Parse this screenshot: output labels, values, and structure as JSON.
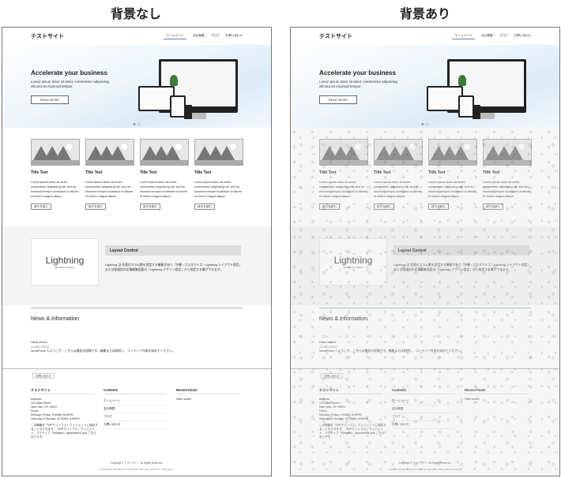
{
  "labels": {
    "left": "背景なし",
    "right": "背景あり"
  },
  "site": {
    "title": "テストサイト",
    "nav": [
      "ホームページ",
      "会社概要",
      "ブログ",
      "お問い合わせ"
    ],
    "hero": {
      "heading": "Accelerate your business",
      "text": "Lorem ipsum dolor sit amet, consectetur adipiscing elit,sed do eiusmod tempor.",
      "button": "READ MORE"
    },
    "cards": [
      {
        "title": "Title Text",
        "text": "Lorem ipsum dolor sit amet, consectetur adipiscing elit, sed do eiusmod tempor incididunt ut labore et dolore magna aliqua.",
        "button": "続きを読む"
      },
      {
        "title": "Title Text",
        "text": "Lorem ipsum dolor sit amet, consectetur adipiscing elit, sed do eiusmod tempor incididunt ut labore et dolore magna aliqua.",
        "button": "続きを読む"
      },
      {
        "title": "Title Text",
        "text": "Lorem ipsum dolor sit amet, consectetur adipiscing elit, sed do eiusmod tempor incididunt ut labore et dolore magna aliqua.",
        "button": "続きを読む"
      },
      {
        "title": "Title Text",
        "text": "Lorem ipsum dolor sit amet, consectetur adipiscing elit, sed do eiusmod tempor incididunt ut labore et dolore magna aliqua.",
        "button": "続きを読む"
      }
    ],
    "layout": {
      "logo": "Lightning",
      "logo_sub": "WordPress Theme",
      "title": "Layout Control",
      "text": "Lightning は 任意のカラム数を設定する機能があり「外観 › カスタマイズ › Lightning レイアウト設定」または各個別の記事編集画面の「Lightning デザイン設定」から指定する事ができます。"
    },
    "news": {
      "title": "News & Information",
      "post_title": "Hello world!",
      "post_date": "2023年12月6日",
      "post_excerpt": "WordPress へようこそ。こちらは最初の投稿です。編集または削除し、コンテンツ作成を始めてください。"
    },
    "footer": {
      "button": "お問い合わせ",
      "col1_title": "テストサイト",
      "col1_lines": [
        "Address",
        "123 Main Street",
        "New York, NY 10001",
        "Hours",
        "Monday–Friday: 9:00AM–5:00PM",
        "Saturday & Sunday: 11:00AM–3:00PM"
      ],
      "col1_text": "この情報を「WPクリップス」ウィジェットに保存することもできます。「WPクリップス」ウィジェット、アクティブ「Widgets」appearance.php こちらをどうぞ。",
      "col2_title": "Contents",
      "col2_items": [
        "ホームページ",
        "会社概要",
        "ブログ",
        "お問い合わせ"
      ],
      "col3_title": "Recent Posts",
      "col3_items": [
        "Hello world!"
      ],
      "copyright": "Copyright © テストサイト All Rights Reserved.",
      "powered": "Powered by WordPress & Lightning Theme by Vektor,Inc. technology."
    }
  }
}
